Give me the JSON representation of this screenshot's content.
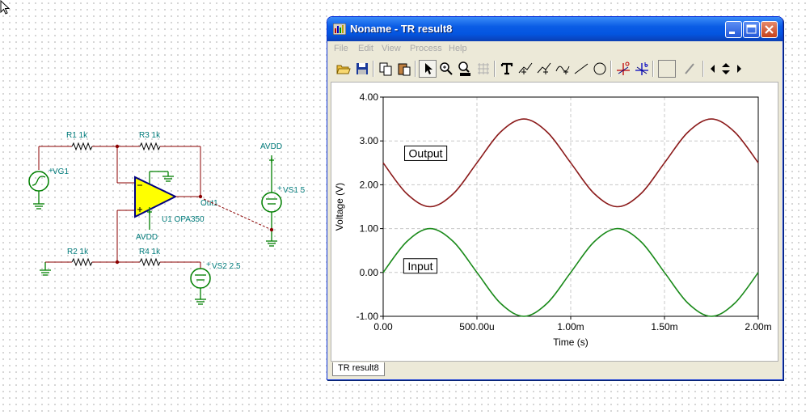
{
  "window": {
    "title": "Noname - TR result8",
    "menu": [
      "File",
      "Edit",
      "View",
      "Process",
      "Help"
    ],
    "tab": "TR result8",
    "toolbar_tools": [
      "open-icon",
      "save-icon",
      "copy-icon",
      "paste-icon",
      "select-pointer-icon",
      "zoom-in-icon",
      "zoom-100-icon",
      "grid-icon",
      "text-tool-icon",
      "cursor-tool-icon",
      "cursor-tool-2-icon",
      "cursor-tool-3-icon",
      "line-tool-icon",
      "circle-tool-icon",
      "marker-a-icon",
      "marker-b-icon",
      "blank-tool-icon",
      "pen-tool-icon",
      "arrow-left-icon",
      "arrow-updown-icon",
      "arrow-right-icon"
    ]
  },
  "schematic": {
    "labels": {
      "r1": "R1 1k",
      "r3": "R3 1k",
      "r2": "R2 1k",
      "r4": "R4 1k",
      "vg1": "VG1",
      "u1": "U1 OPA350",
      "avdd_top": "AVDD",
      "avdd_bottom": "AVDD",
      "out1": "Out1",
      "vs1": "VS1 5",
      "vs2": "VS2 2.5",
      "plus_sign": "+"
    }
  },
  "chart_data": {
    "type": "line",
    "xlabel": "Time (s)",
    "ylabel": "Voltage (V)",
    "xlim": [
      0,
      0.002
    ],
    "ylim": [
      -1,
      4
    ],
    "x_ticks": [
      {
        "value": 0,
        "label": "0.00"
      },
      {
        "value": 0.0005,
        "label": "500.00u"
      },
      {
        "value": 0.001,
        "label": "1.00m"
      },
      {
        "value": 0.0015,
        "label": "1.50m"
      },
      {
        "value": 0.002,
        "label": "2.00m"
      }
    ],
    "y_ticks": [
      {
        "value": -1,
        "label": "-1.00"
      },
      {
        "value": 0,
        "label": "0.00"
      },
      {
        "value": 1,
        "label": "1.00"
      },
      {
        "value": 2,
        "label": "2.00"
      },
      {
        "value": 3,
        "label": "3.00"
      },
      {
        "value": 4,
        "label": "4.00"
      }
    ],
    "grid": true,
    "series": [
      {
        "name": "Output",
        "color": "#8b1a1a",
        "x": [
          0,
          0.000125,
          0.00025,
          0.000375,
          0.0005,
          0.000625,
          0.00075,
          0.000875,
          0.001,
          0.001125,
          0.00125,
          0.001375,
          0.0015,
          0.001625,
          0.00175,
          0.001875,
          0.002
        ],
        "y": [
          2.5,
          1.8,
          1.5,
          1.8,
          2.5,
          3.2,
          3.5,
          3.2,
          2.5,
          1.8,
          1.5,
          1.8,
          2.5,
          3.2,
          3.5,
          3.2,
          2.5
        ]
      },
      {
        "name": "Input",
        "color": "#1a8a1a",
        "x": [
          0,
          0.000125,
          0.00025,
          0.000375,
          0.0005,
          0.000625,
          0.00075,
          0.000875,
          0.001,
          0.001125,
          0.00125,
          0.001375,
          0.0015,
          0.001625,
          0.00175,
          0.001875,
          0.002
        ],
        "y": [
          0,
          0.7,
          1.0,
          0.7,
          0,
          -0.7,
          -1.0,
          -0.7,
          0,
          0.7,
          1.0,
          0.7,
          0,
          -0.7,
          -1.0,
          -0.7,
          0
        ]
      }
    ],
    "annotations": [
      {
        "text": "Output",
        "x": 0.00011,
        "y": 2.7
      },
      {
        "text": "Input",
        "x": 0.000105,
        "y": 0.13
      }
    ]
  }
}
